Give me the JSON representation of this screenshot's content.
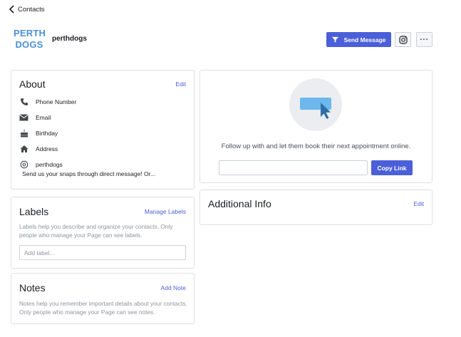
{
  "nav": {
    "back_label": "Contacts"
  },
  "profile": {
    "logo_text_line1": "PERTH",
    "logo_text_line2": "DOGS",
    "name": "perthdogs"
  },
  "actions": {
    "send_message_label": "Send Message",
    "instagram_icon": "instagram-icon",
    "more_label": "···"
  },
  "about": {
    "title": "About",
    "edit_label": "Edit",
    "rows": [
      {
        "icon": "phone-icon",
        "label": "Phone Number"
      },
      {
        "icon": "email-icon",
        "label": "Email"
      },
      {
        "icon": "birthday-cake-icon",
        "label": "Birthday"
      },
      {
        "icon": "home-icon",
        "label": "Address"
      },
      {
        "icon": "instagram-handle-icon",
        "label": "perthdogs"
      }
    ],
    "description": "Send us your snaps through direct message! Or..."
  },
  "labels": {
    "title": "Labels",
    "manage_label": "Manage Labels",
    "help_text": "Labels help you describe and organize your contacts. Only people who manage your Page can see labels.",
    "input_placeholder": "Add label..."
  },
  "notes": {
    "title": "Notes",
    "add_label": "Add Note",
    "help_text": "Notes help you remember important details about your contacts. Only people who manage your Page can see notes."
  },
  "appointment": {
    "text": "Follow up with and let them book their next appointment online.",
    "link_value": "",
    "copy_label": "Copy Link"
  },
  "additional_info": {
    "title": "Additional Info",
    "edit_label": "Edit"
  },
  "colors": {
    "accent": "#4b5fd8",
    "logo": "#4a90d9",
    "illustration_screen": "#6cb8ec",
    "illustration_cursor": "#2f6fa8"
  }
}
